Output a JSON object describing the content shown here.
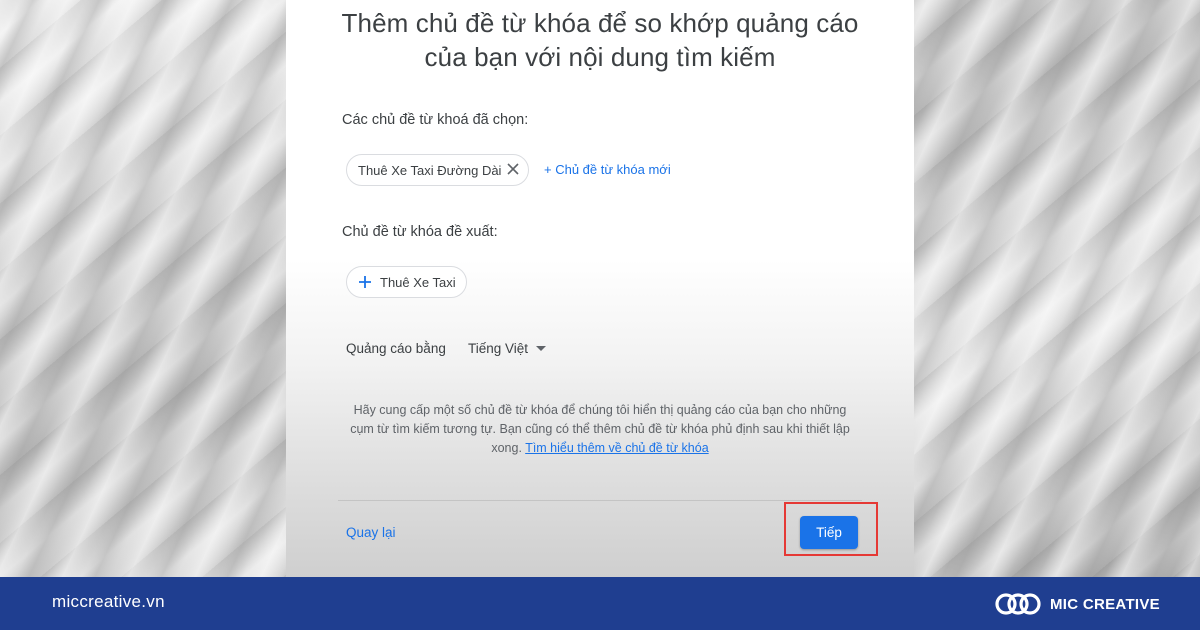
{
  "dialog": {
    "title_line1": "Thêm chủ đề từ khóa để so khớp quảng cáo",
    "title_line2": "của bạn với nội dung tìm kiếm",
    "selected_label": "Các chủ đề từ khoá đã chọn:",
    "selected_chips": [
      "Thuê Xe Taxi Đường Dài"
    ],
    "add_new_label": "+ Chủ đề từ khóa mới",
    "suggested_label": "Chủ đề từ khóa đề xuất:",
    "suggested_chips": [
      "Thuê Xe Taxi"
    ],
    "language_label": "Quảng cáo bằng",
    "language_value": "Tiếng Việt",
    "help_text": "Hãy cung cấp một số chủ đề từ khóa để chúng tôi hiển thị quảng cáo của bạn cho những cụm từ tìm kiếm tương tự. Bạn cũng có thể thêm chủ đề từ khóa phủ định sau khi thiết lập xong.",
    "help_link": "Tìm hiểu thêm về chủ đề từ khóa",
    "back_label": "Quay lại",
    "next_label": "Tiếp"
  },
  "footer": {
    "site": "miccreative.vn",
    "brand": "MIC CREATIVE"
  },
  "icons": {
    "remove_chip": "close-icon",
    "add_chip": "plus-icon",
    "dropdown": "caret-down-icon",
    "logo": "mic-creative-logo-icon"
  },
  "colors": {
    "accent": "#1a73e8",
    "footer_bg": "#1f3e90",
    "highlight": "#e53935"
  }
}
